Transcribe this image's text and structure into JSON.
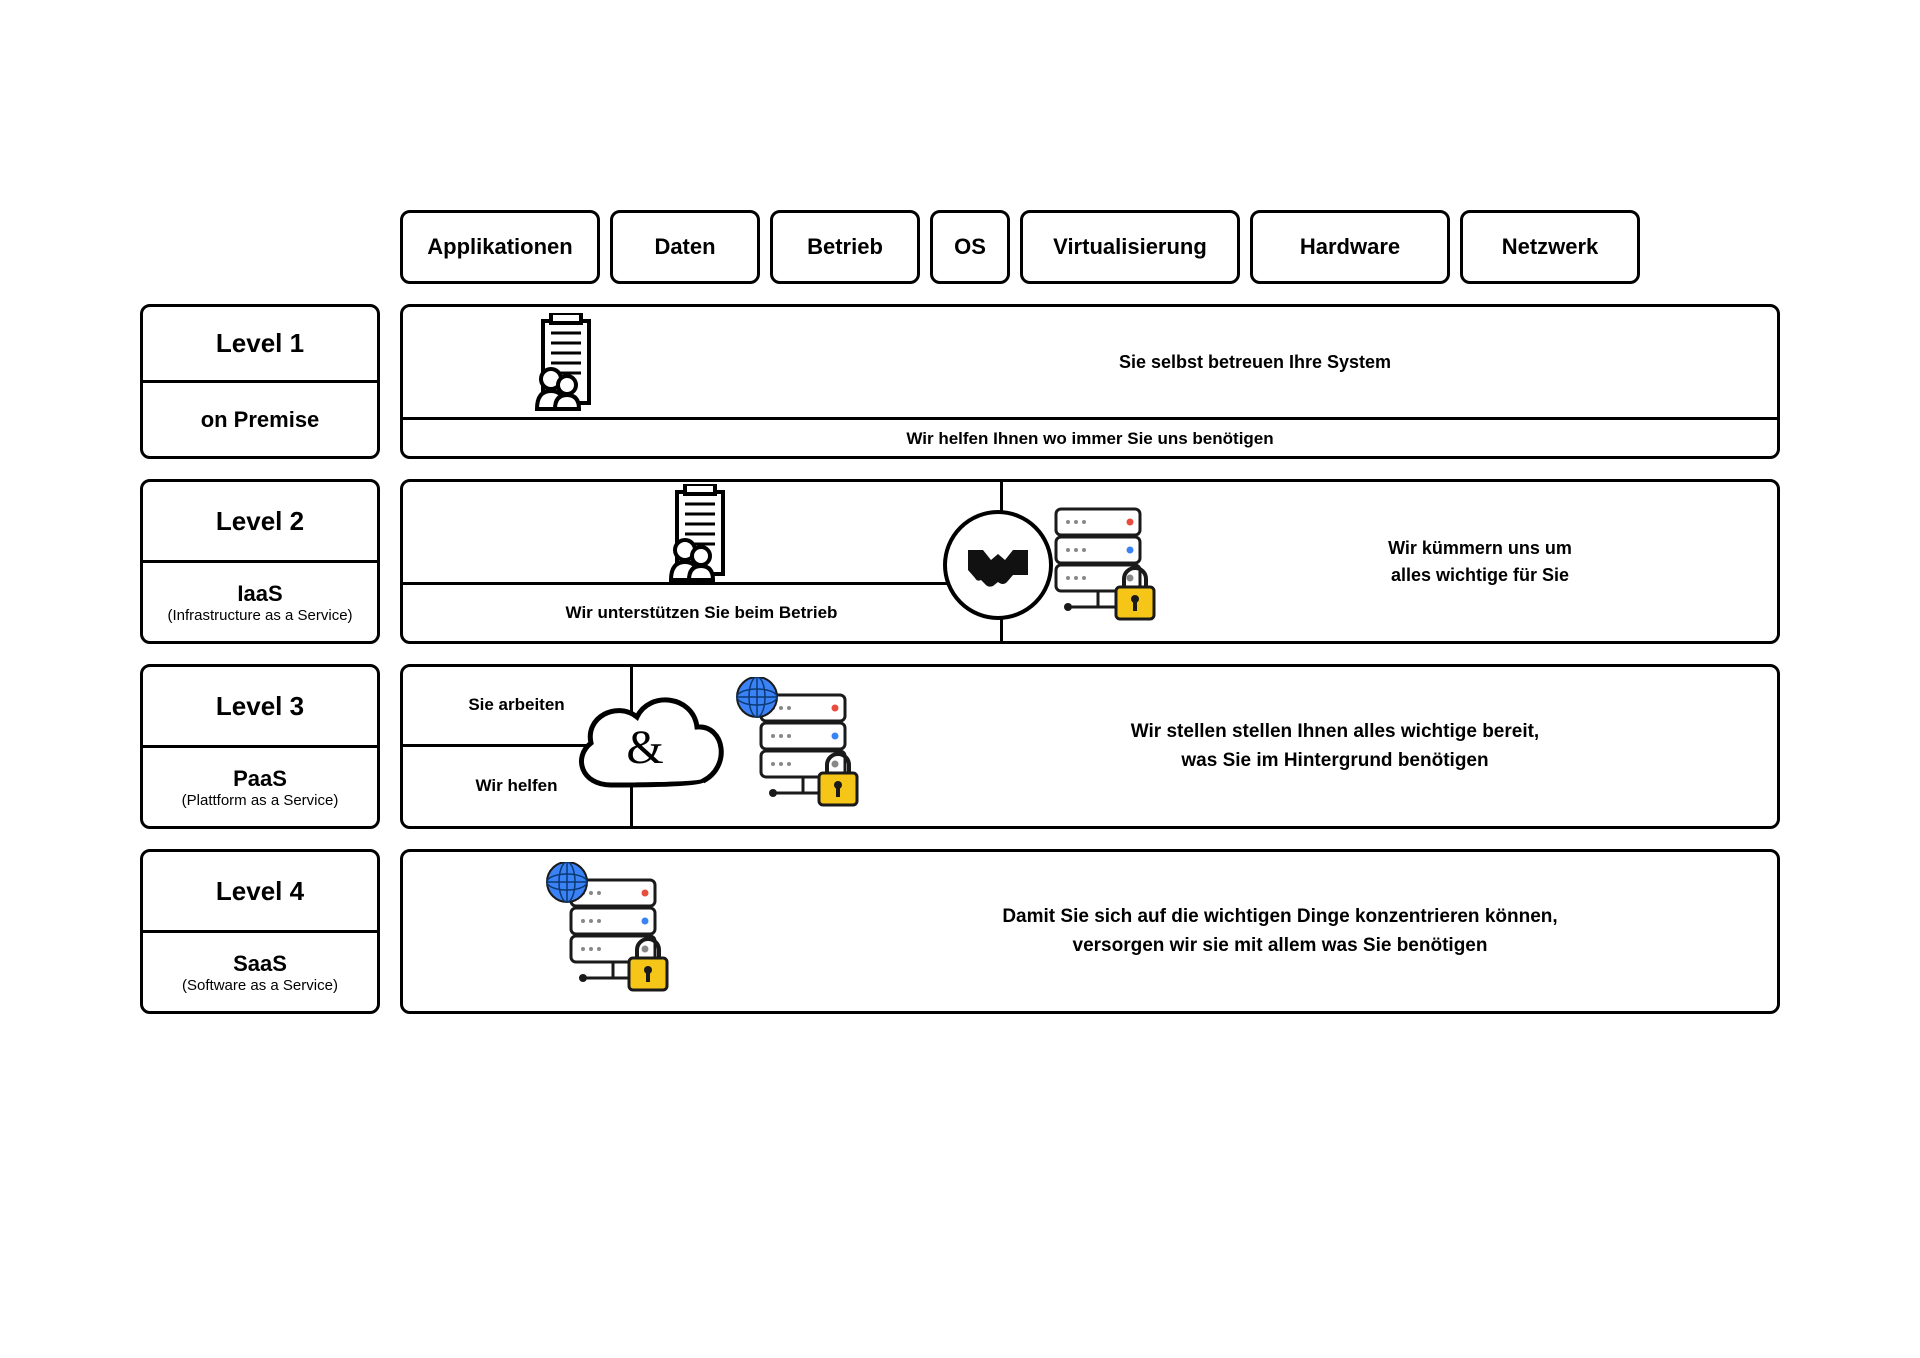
{
  "headers": [
    "Applikationen",
    "Daten",
    "Betrieb",
    "OS",
    "Virtualisierung",
    "Hardware",
    "Netzwerk"
  ],
  "levels": {
    "l1": {
      "title": "Level 1",
      "name": "on Premise",
      "sub": "",
      "top_text": "Sie selbst betreuen Ihre System",
      "bottom_text": "Wir helfen Ihnen wo immer Sie uns benötigen"
    },
    "l2": {
      "title": "Level 2",
      "name": "IaaS",
      "sub": "(Infrastructure as a Service)",
      "left_bottom": "Wir unterstützen Sie beim Betrieb",
      "right_text": "Wir kümmern uns um\nalles wichtige für Sie"
    },
    "l3": {
      "title": "Level 3",
      "name": "PaaS",
      "sub": "(Plattform as a Service)",
      "left_top": "Sie arbeiten",
      "left_bottom": "Wir helfen",
      "right_text": "Wir stellen stellen Ihnen alles wichtige bereit,\nwas Sie im Hintergrund benötigen"
    },
    "l4": {
      "title": "Level 4",
      "name": "SaaS",
      "sub": "(Software as a Service)",
      "text": "Damit Sie sich auf die wichtigen Dinge konzentrieren können,\nversorgen wir sie mit allem was Sie benötigen"
    }
  },
  "cloud_symbol": "&"
}
